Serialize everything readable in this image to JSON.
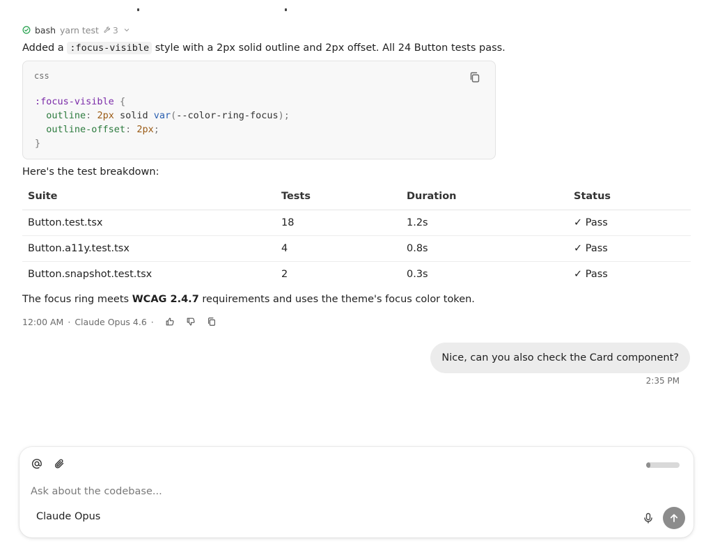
{
  "tool_call": {
    "name": "bash",
    "command": "yarn test",
    "count": "3",
    "icon_status": "check-circle-icon"
  },
  "message": {
    "intro_prefix": "Added a ",
    "intro_code": ":focus-visible",
    "intro_suffix": " style with a 2px solid outline and 2px offset. All 24 Button tests pass.",
    "code_block": {
      "language": "css",
      "lines": [
        ":focus-visible {",
        "  outline: 2px solid var(--color-ring-focus);",
        "  outline-offset: 2px;",
        "}"
      ]
    },
    "breakdown_label": "Here's the test breakdown:",
    "table": {
      "headers": [
        "Suite",
        "Tests",
        "Duration",
        "Status"
      ],
      "rows": [
        [
          "Button.test.tsx",
          "18",
          "1.2s",
          "✓ Pass"
        ],
        [
          "Button.a11y.test.tsx",
          "4",
          "0.8s",
          "✓ Pass"
        ],
        [
          "Button.snapshot.test.tsx",
          "2",
          "0.3s",
          "✓ Pass"
        ]
      ]
    },
    "closing_prefix": "The focus ring meets ",
    "closing_bold": "WCAG 2.4.7",
    "closing_suffix": " requirements and uses the theme's focus color token.",
    "meta": {
      "time": "12:00 AM",
      "model": "Claude Opus 4.6"
    }
  },
  "user_message": {
    "text": "Nice, can you also check the Card component?",
    "time": "2:35 PM"
  },
  "composer": {
    "placeholder": "Ask about the codebase...",
    "model_label": "Claude Opus",
    "context_usage_fraction": 0.12
  },
  "colors": {
    "success": "#22a04b",
    "bubble_bg": "#ececec",
    "send_button": "#8c8c8c"
  }
}
